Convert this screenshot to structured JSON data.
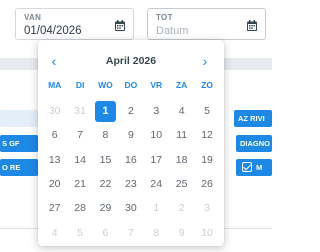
{
  "date_range": {
    "from_label": "VAN",
    "from_value": "01/04/2026",
    "to_label": "TOT",
    "to_placeholder": "Datum"
  },
  "background": {
    "chips": [
      "AZ RIVI",
      "S GF",
      "DIAGNO",
      "O RE",
      "M"
    ]
  },
  "calendar": {
    "month_title": "April 2026",
    "prev_symbol": "‹",
    "next_symbol": "›",
    "weekdays": [
      "MA",
      "DI",
      "WO",
      "DO",
      "VR",
      "ZA",
      "ZO"
    ],
    "selected_day": "1",
    "weeks": [
      [
        {
          "d": "30",
          "out": true
        },
        {
          "d": "31",
          "out": true
        },
        {
          "d": "1",
          "sel": true
        },
        {
          "d": "2"
        },
        {
          "d": "3"
        },
        {
          "d": "4"
        },
        {
          "d": "5"
        }
      ],
      [
        {
          "d": "6"
        },
        {
          "d": "7"
        },
        {
          "d": "8"
        },
        {
          "d": "9"
        },
        {
          "d": "10"
        },
        {
          "d": "11"
        },
        {
          "d": "12"
        }
      ],
      [
        {
          "d": "13"
        },
        {
          "d": "14"
        },
        {
          "d": "15"
        },
        {
          "d": "16"
        },
        {
          "d": "17"
        },
        {
          "d": "18"
        },
        {
          "d": "19"
        }
      ],
      [
        {
          "d": "20"
        },
        {
          "d": "21"
        },
        {
          "d": "22"
        },
        {
          "d": "23"
        },
        {
          "d": "24"
        },
        {
          "d": "25"
        },
        {
          "d": "26"
        }
      ],
      [
        {
          "d": "27"
        },
        {
          "d": "28"
        },
        {
          "d": "29"
        },
        {
          "d": "30"
        },
        {
          "d": "1",
          "out": true
        },
        {
          "d": "2",
          "out": true
        },
        {
          "d": "3",
          "out": true
        }
      ],
      [
        {
          "d": "4",
          "out": true
        },
        {
          "d": "5",
          "out": true
        },
        {
          "d": "6",
          "out": true
        },
        {
          "d": "7",
          "out": true
        },
        {
          "d": "8",
          "out": true
        },
        {
          "d": "9",
          "out": true
        },
        {
          "d": "10",
          "out": true
        }
      ]
    ]
  },
  "colors": {
    "accent": "#1e88e5",
    "text": "#5d6770",
    "muted": "#c9cfd4"
  }
}
